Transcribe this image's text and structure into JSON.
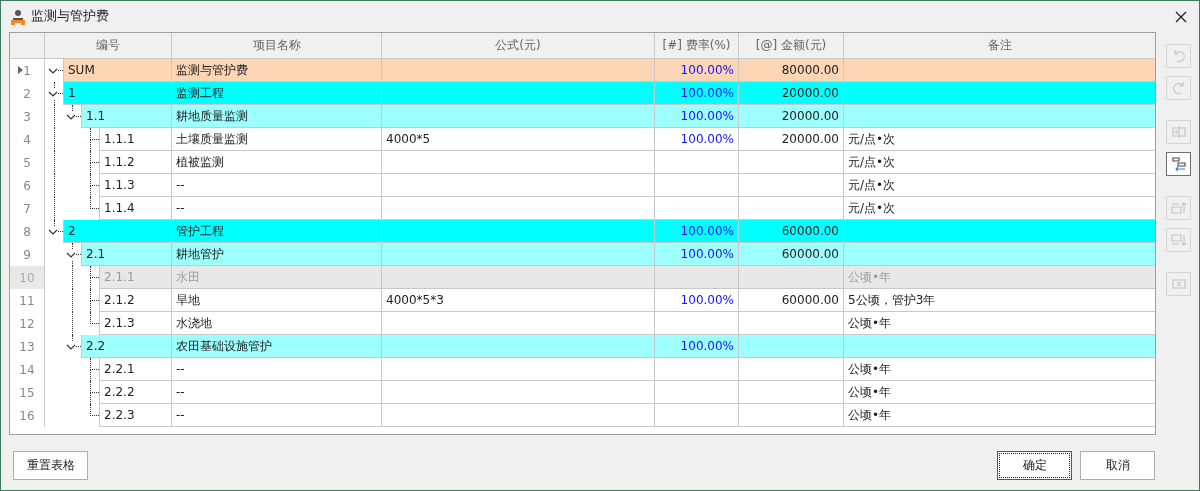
{
  "window": {
    "title": "监测与管护费"
  },
  "table": {
    "columns": [
      "编号",
      "项目名称",
      "公式(元)",
      "[#] 费率(%)",
      "[@] 金额(元)",
      "备注"
    ],
    "rows": [
      {
        "no": "1",
        "code": "SUM",
        "name": "监测与管护费",
        "rate": "100.00%",
        "amount": "80000.00",
        "kind": "total",
        "selected": true,
        "disabled": false,
        "expanded": true,
        "children": [
          {
            "no": "2",
            "code": "1",
            "name": "监测工程",
            "rate": "100.00%",
            "amount": "20000.00",
            "kind": "group",
            "selected": false,
            "disabled": false,
            "expanded": true,
            "children": [
              {
                "no": "3",
                "code": "1.1",
                "name": "耕地质量监测",
                "rate": "100.00%",
                "amount": "20000.00",
                "kind": "subgroup",
                "selected": false,
                "disabled": false,
                "expanded": true,
                "children": [
                  {
                    "no": "4",
                    "code": "1.1.1",
                    "name": "土壤质量监测",
                    "formula": "4000*5",
                    "rate": "100.00%",
                    "amount": "20000.00",
                    "note": "元/点•次",
                    "selected": false,
                    "disabled": false
                  },
                  {
                    "no": "5",
                    "code": "1.1.2",
                    "name": "植被监测",
                    "note": "元/点•次",
                    "selected": false,
                    "disabled": false
                  },
                  {
                    "no": "6",
                    "code": "1.1.3",
                    "name": "--",
                    "note": "元/点•次",
                    "selected": false,
                    "disabled": false
                  },
                  {
                    "no": "7",
                    "code": "1.1.4",
                    "name": "--",
                    "note": "元/点•次",
                    "selected": false,
                    "disabled": false
                  }
                ]
              }
            ]
          },
          {
            "no": "8",
            "code": "2",
            "name": "管护工程",
            "rate": "100.00%",
            "amount": "60000.00",
            "kind": "group",
            "selected": false,
            "disabled": false,
            "expanded": true,
            "children": [
              {
                "no": "9",
                "code": "2.1",
                "name": "耕地管护",
                "rate": "100.00%",
                "amount": "60000.00",
                "kind": "subgroup",
                "selected": false,
                "disabled": false,
                "expanded": true,
                "children": [
                  {
                    "no": "10",
                    "code": "2.1.1",
                    "name": "水田",
                    "note": "公顷•年",
                    "selected": false,
                    "disabled": true
                  },
                  {
                    "no": "11",
                    "code": "2.1.2",
                    "name": "旱地",
                    "formula": "4000*5*3",
                    "rate": "100.00%",
                    "amount": "60000.00",
                    "note": "5公顷，管护3年",
                    "selected": false,
                    "disabled": false
                  },
                  {
                    "no": "12",
                    "code": "2.1.3",
                    "name": "水浇地",
                    "note": "公顷•年",
                    "selected": false,
                    "disabled": false
                  }
                ]
              },
              {
                "no": "13",
                "code": "2.2",
                "name": "农田基础设施管护",
                "rate": "100.00%",
                "kind": "subgroup",
                "selected": false,
                "disabled": false,
                "expanded": true,
                "children": [
                  {
                    "no": "14",
                    "code": "2.2.1",
                    "name": "--",
                    "note": "公顷•年",
                    "selected": false,
                    "disabled": false
                  },
                  {
                    "no": "15",
                    "code": "2.2.2",
                    "name": "--",
                    "note": "公顷•年",
                    "selected": false,
                    "disabled": false
                  },
                  {
                    "no": "16",
                    "code": "2.2.3",
                    "name": "--",
                    "note": "公顷•年",
                    "selected": false,
                    "disabled": false
                  }
                ]
              }
            ]
          }
        ]
      }
    ]
  },
  "toolbar": {
    "groups": [
      {
        "tools": [
          {
            "kind": "undo",
            "disabled": true
          },
          {
            "kind": "redo",
            "disabled": true
          }
        ]
      },
      {
        "tools": [
          {
            "kind": "split",
            "disabled": true
          },
          {
            "kind": "outdent",
            "disabled": false
          }
        ]
      },
      {
        "tools": [
          {
            "kind": "insert-above",
            "disabled": true
          },
          {
            "kind": "insert-below",
            "disabled": true
          }
        ]
      },
      {
        "tools": [
          {
            "kind": "delete",
            "disabled": true
          }
        ]
      }
    ]
  },
  "buttons": [
    {
      "label": "重置表格",
      "kind": "reset",
      "default": false
    },
    {
      "label": "确定",
      "kind": "ok",
      "default": true
    },
    {
      "label": "取消",
      "kind": "cancel",
      "default": false
    }
  ]
}
